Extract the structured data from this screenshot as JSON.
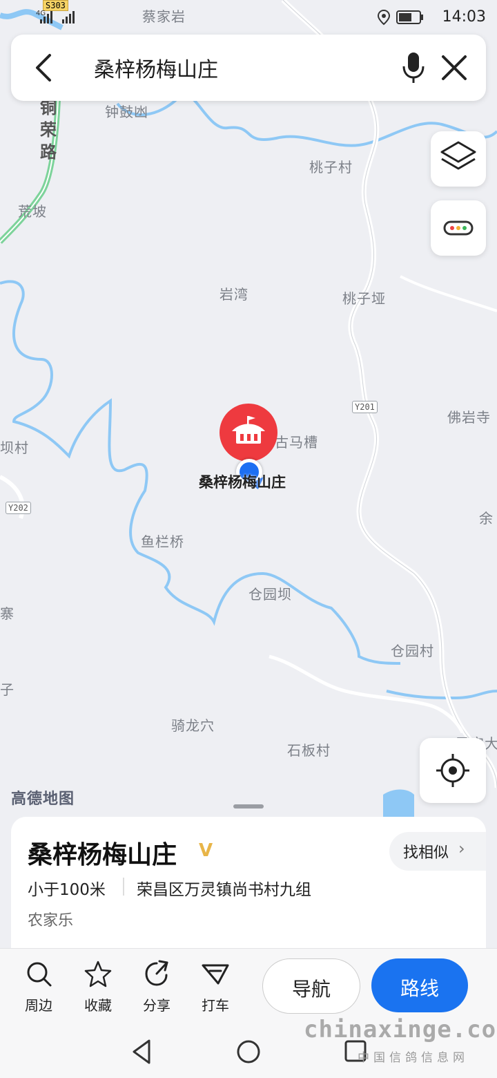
{
  "status_bar": {
    "time": "14:03",
    "network": "4G",
    "route_shield": "S303"
  },
  "search": {
    "query": "桑梓杨梅山庄"
  },
  "map": {
    "place_names": [
      "蔡家岩",
      "钟鼓凼",
      "桃子村",
      "荒坡",
      "岩湾",
      "桃子垭",
      "佛岩寺",
      "坝村",
      "古马槽",
      "鱼栏桥",
      "余",
      "仓园坝",
      "寨",
      "仓园村",
      "子",
      "骑龙穴",
      "石板村",
      "民宝大"
    ],
    "road_labels": [
      "铜荣路",
      "Y201",
      "Y202"
    ],
    "poi_label": "桑梓杨梅山庄",
    "brand_logo": "高德地图"
  },
  "card": {
    "title": "桑梓杨梅山庄",
    "badge": "V",
    "similar_button": "找相似",
    "distance": "小于100米",
    "address": "荣昌区万灵镇尚书村九组",
    "category": "农家乐"
  },
  "actions": {
    "nearby": "周边",
    "favorite": "收藏",
    "share": "分享",
    "taxi": "打车",
    "navigate": "导航",
    "route": "路线"
  },
  "watermark": {
    "domain": "chinaxinge.com",
    "subtitle": "中国信鸽信息网"
  },
  "colors": {
    "accent": "#1a73f0",
    "marker": "#ee3a3f",
    "river": "#8ec8f5"
  }
}
